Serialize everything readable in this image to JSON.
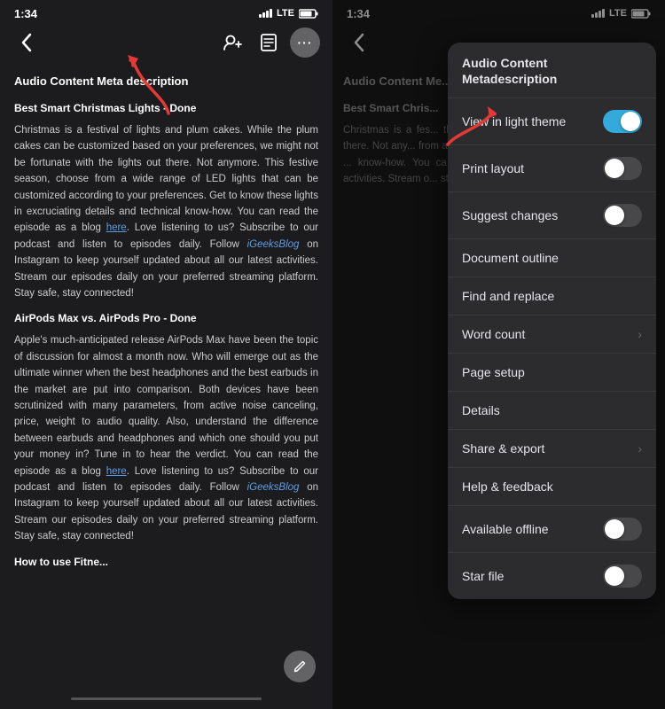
{
  "left": {
    "status_time": "1:34",
    "status_signal": "LTE",
    "toolbar": {
      "back_label": "‹",
      "add_person_icon": "👤+",
      "doc_icon": "☰",
      "more_icon": "•••"
    },
    "doc": {
      "title": "Audio Content Meta description",
      "section1_title": "Best Smart Christmas Lights - Done",
      "section1_para1": "Christmas is a festival of lights and plum cakes. While the plum cakes can be customized based on your preferences, we might not be fortunate with the lights out there. Not anymore. This festive season, choose from a wide range of LED lights that can be customized according to your preferences. Get to know these lights in excruciating details and technical know-how. You can read the episode as a blog ",
      "section1_link1": "here",
      "section1_para1b": ". Love listening to us? Subscribe to our podcast and listen to episodes daily. Follow ",
      "section1_italic": "iGeeksBlog",
      "section1_para1c": " on Instagram to keep yourself updated about all our latest activities. Stream our episodes daily on your preferred streaming platform. Stay safe, stay connected!",
      "section2_title": "AirPods Max vs. AirPods Pro - Done",
      "section2_para1": "Apple's much-anticipated release AirPods Max have been the topic of discussion for almost a month now. Who will emerge out as the ultimate winner when the best headphones and the best earbuds in the market are put into comparison. Both devices have been scrutinized with many parameters, from active noise canceling, price, weight to audio quality. Also, understand the difference between earbuds and headphones and which one should you put your money in? Tune in to hear the verdict. You can read the episode as a blog ",
      "section2_link1": "here",
      "section2_para1b": ". Love listening to us? Subscribe to our podcast and listen to episodes daily. Follow ",
      "section2_italic": "iGeeksBlog",
      "section2_para1c": " on Instagram to keep yourself updated about all our latest activities. Stream our episodes daily on your preferred streaming platform. Stay safe, stay connected!",
      "section3_title": "How to use Fitne..."
    }
  },
  "right": {
    "status_time": "1:34",
    "status_signal": "LTE",
    "doc": {
      "title": "Audio Content Me...",
      "section1_title": "Best Smart Chris...",
      "section1_para": "Christmas is a fes... the plum cakes c... preferences, we m... out there. Not any... from a wide ran... customized accor... these lights in ... know-how. You ca... listen to episode... Instagram to keep... activities. Stream o... streaming platform."
    },
    "menu": {
      "header_title": "Audio Content\nMetadescription",
      "items": [
        {
          "label": "View in light theme",
          "type": "toggle_on"
        },
        {
          "label": "Print layout",
          "type": "toggle_off"
        },
        {
          "label": "Suggest changes",
          "type": "toggle_off"
        },
        {
          "label": "Document outline",
          "type": "none"
        },
        {
          "label": "Find and replace",
          "type": "none"
        },
        {
          "label": "Word count",
          "type": "chevron"
        },
        {
          "label": "Page setup",
          "type": "none"
        },
        {
          "label": "Details",
          "type": "none"
        },
        {
          "label": "Share & export",
          "type": "chevron"
        },
        {
          "label": "Help & feedback",
          "type": "none"
        },
        {
          "label": "Available offline",
          "type": "toggle_off"
        },
        {
          "label": "Star file",
          "type": "toggle_off"
        }
      ]
    }
  }
}
